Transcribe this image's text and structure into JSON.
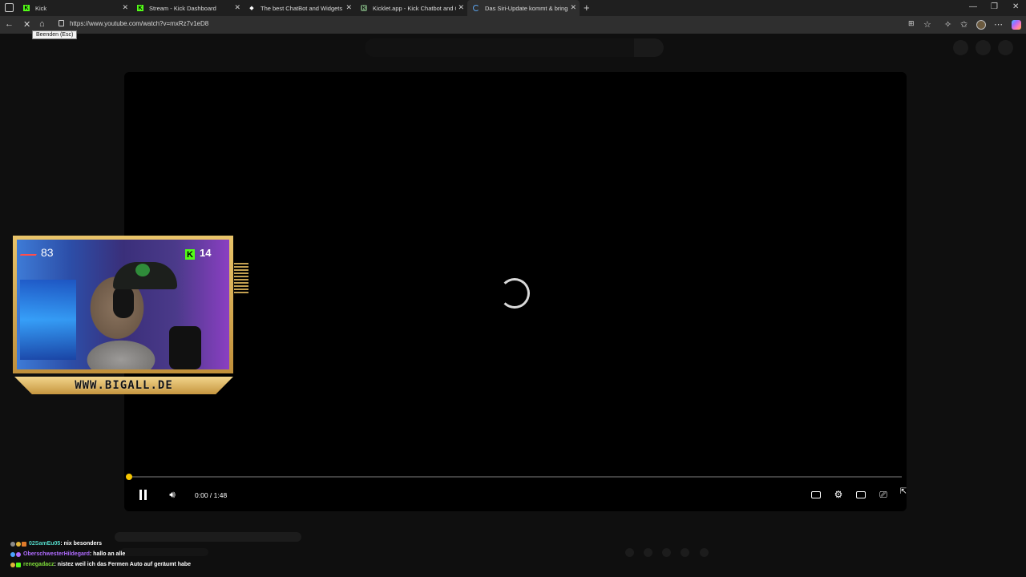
{
  "browser": {
    "tabs": [
      {
        "title": "Kick",
        "favicon": "kick-icon",
        "active": false
      },
      {
        "title": "Stream - Kick Dashboard",
        "favicon": "kick-icon",
        "active": false
      },
      {
        "title": "The best ChatBot and Widgets fo",
        "favicon": "diamond-icon",
        "active": false
      },
      {
        "title": "Kicklet.app - Kick Chatbot and Ov",
        "favicon": "kicklet-icon",
        "active": false
      },
      {
        "title": "Das Siri-Update kommt & bring",
        "favicon": "loading-icon",
        "active": true
      }
    ],
    "new_tab_symbol": "+",
    "url": "https://www.youtube.com/watch?v=mxRz7v1eD8",
    "tooltip": "Beenden (Esc)"
  },
  "player": {
    "current_time": "0:00",
    "duration": "1:48",
    "time_display": "0:00 / 1:48",
    "progress_fraction": 0.0,
    "scrubber_color": "#f7c600",
    "state": "loading"
  },
  "overlay": {
    "heart_rate": "83",
    "kick_viewers": "14",
    "banner": "WWW.BIGALL.DE",
    "frame_color": "#e9c46a"
  },
  "chat": [
    {
      "user": "02SamEu05",
      "message": ": nix besonders",
      "color": "#53d6c6"
    },
    {
      "user": "OberschwesterHildegard",
      "message": ": hallo an alle",
      "color": "#b06cff"
    },
    {
      "user": "renegadacz",
      "message": ": nistez weil ich das Fermen Auto auf geräumt habe",
      "color": "#7fdc3a"
    }
  ]
}
